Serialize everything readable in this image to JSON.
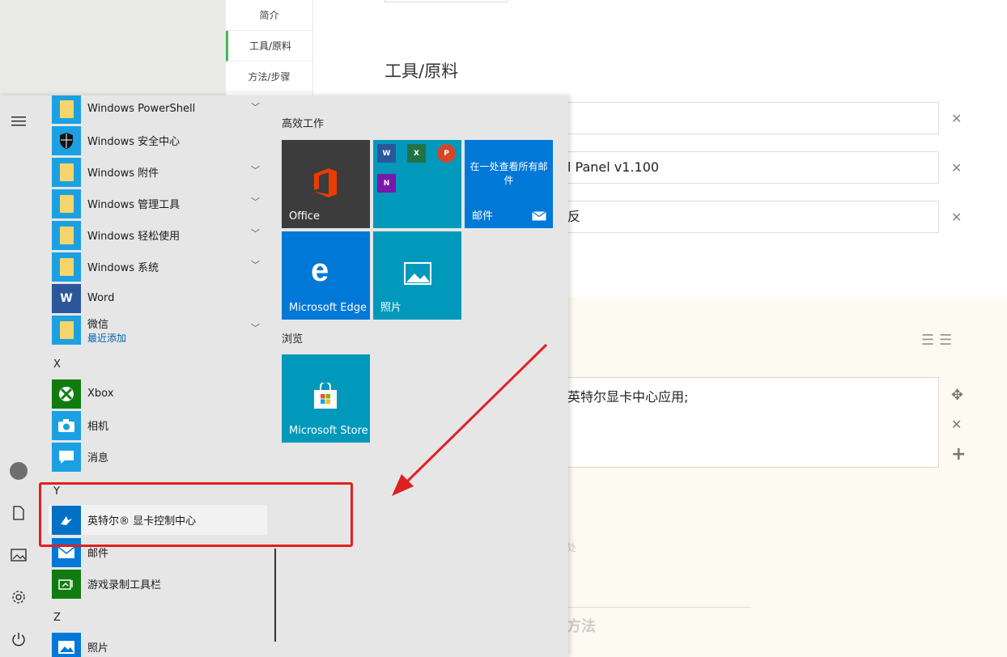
{
  "page": {
    "nav": [
      "简介",
      "工具/原料",
      "方法/步骤"
    ],
    "section_title": "工具/原料",
    "inputs": [
      "",
      "l Panel v1.100",
      "反"
    ],
    "step_text": "英特尔显卡中心应用;",
    "faint_text": "处",
    "method_heading": "方法"
  },
  "start_menu": {
    "apps": [
      {
        "label": "Windows PowerShell",
        "icon": "folder-icon",
        "expandable": true
      },
      {
        "label": "Windows 安全中心",
        "icon": "shield-icon",
        "expandable": false
      },
      {
        "label": "Windows 附件",
        "icon": "folder-icon",
        "expandable": true
      },
      {
        "label": "Windows 管理工具",
        "icon": "folder-icon",
        "expandable": true
      },
      {
        "label": "Windows 轻松使用",
        "icon": "folder-icon",
        "expandable": true
      },
      {
        "label": "Windows 系统",
        "icon": "folder-icon",
        "expandable": true
      },
      {
        "label": "Word",
        "icon": "word-icon",
        "expandable": false
      },
      {
        "label": "微信",
        "sublabel": "最近添加",
        "icon": "folder-icon",
        "expandable": true
      }
    ],
    "letters": {
      "x": "X",
      "y": "Y",
      "z": "Z"
    },
    "apps_x": [
      {
        "label": "Xbox",
        "icon": "xbox-icon"
      },
      {
        "label": "相机",
        "icon": "camera-icon"
      },
      {
        "label": "消息",
        "icon": "message-icon"
      }
    ],
    "apps_y": [
      {
        "label": "英特尔® 显卡控制中心",
        "icon": "intel-graphics-icon"
      },
      {
        "label": "邮件",
        "icon": "mail-icon"
      },
      {
        "label": "游戏录制工具栏",
        "icon": "game-bar-icon"
      }
    ],
    "apps_z": [
      {
        "label": "照片",
        "icon": "photos-icon"
      }
    ],
    "tile_groups": [
      "高效工作",
      "浏览"
    ],
    "tiles": {
      "office": "Office",
      "mail_tile_text": "在一处查看所有邮件",
      "mail_tile_label": "邮件",
      "edge": "Microsoft Edge",
      "photos": "照片",
      "store": "Microsoft Store",
      "mini_apps": [
        "W",
        "X",
        "P",
        "N"
      ]
    }
  },
  "colors": {
    "accent": "#0078d7",
    "annotation": "#e02020",
    "tile_blue": "#0099bc",
    "office_tile": "#3c3c3c"
  }
}
